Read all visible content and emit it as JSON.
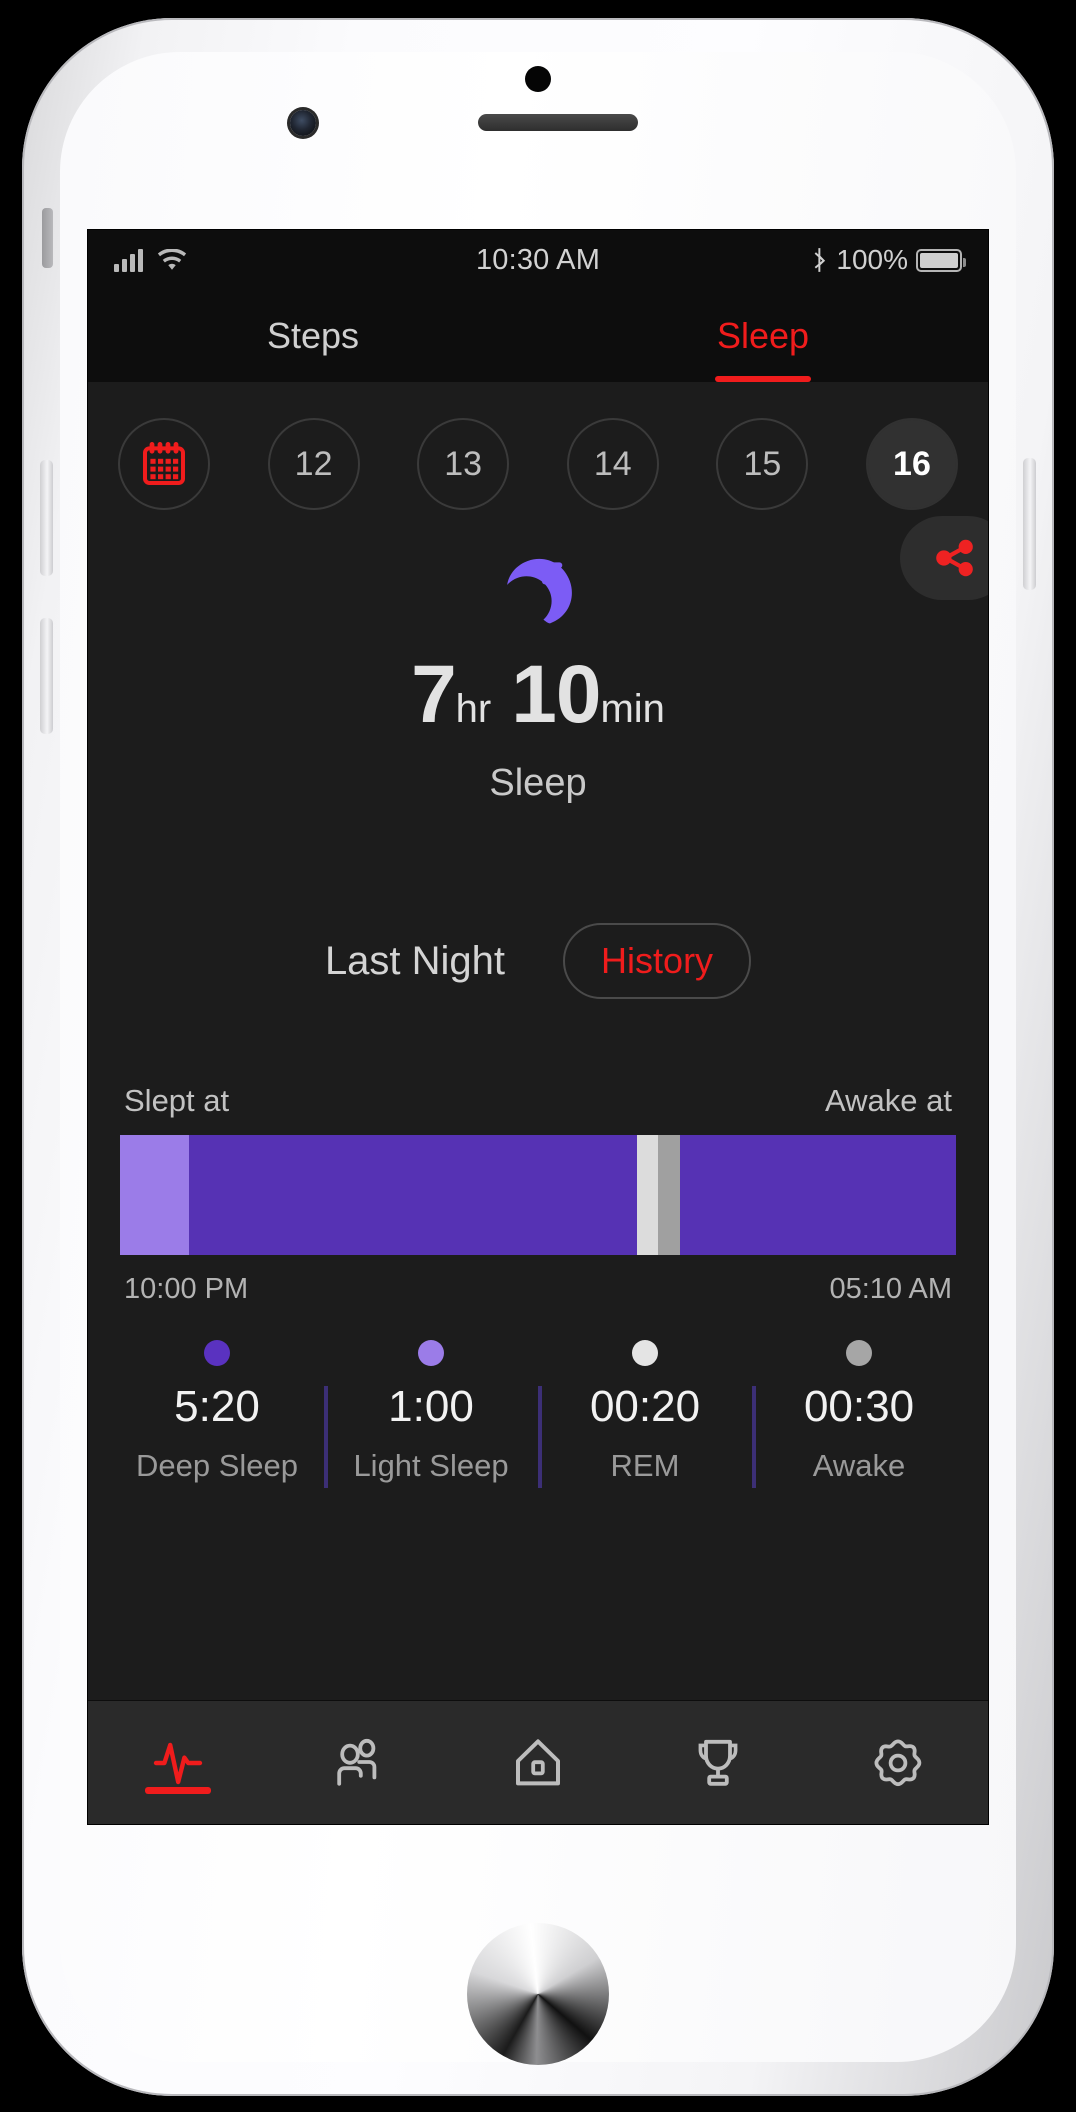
{
  "status_bar": {
    "time": "10:30 AM",
    "battery_percent": "100%",
    "signal_icon": "cellular-signal-icon",
    "wifi_icon": "wifi-icon",
    "bluetooth_icon": "bluetooth-icon",
    "battery_icon": "battery-icon"
  },
  "top_tabs": [
    {
      "label": "Steps",
      "active": false
    },
    {
      "label": "Sleep",
      "active": true
    }
  ],
  "date_strip": {
    "calendar_icon": "calendar-icon",
    "days": [
      "12",
      "13",
      "14",
      "15",
      "16"
    ],
    "selected_day": "16"
  },
  "summary": {
    "moon_icon": "moon-sleep-icon",
    "hours": "7",
    "hours_unit": "hr",
    "minutes": "10",
    "minutes_unit": "min",
    "label": "Sleep",
    "share_icon": "share-icon"
  },
  "section": {
    "title": "Last Night",
    "history_button": "History"
  },
  "chart_data": {
    "type": "bar",
    "title": "Last Night sleep stages timeline",
    "xlabel": "",
    "ylabel": "",
    "start_label": "Slept at",
    "end_label": "Awake at",
    "start_time": "10:00 PM",
    "end_time": "05:10 AM",
    "total_duration": "7hr 10min",
    "segments": [
      {
        "stage": "Light Sleep",
        "percent": 8.3,
        "color": "#9b7ce8"
      },
      {
        "stage": "Deep Sleep",
        "percent": 53.5,
        "color": "#5632b4"
      },
      {
        "stage": "REM",
        "percent": 2.6,
        "color": "#dcdcdc"
      },
      {
        "stage": "Awake",
        "percent": 2.6,
        "color": "#a0a0a0"
      },
      {
        "stage": "Deep Sleep",
        "percent": 33.0,
        "color": "#5632b4"
      }
    ],
    "legend": [
      {
        "label": "Deep Sleep",
        "value": "5:20",
        "color": "#5a32c0"
      },
      {
        "label": "Light Sleep",
        "value": "1:00",
        "color": "#9b7ce8"
      },
      {
        "label": "REM",
        "value": "00:20",
        "color": "#e4e4e4"
      },
      {
        "label": "Awake",
        "value": "00:30",
        "color": "#a6a6a6"
      }
    ]
  },
  "bottom_nav": [
    {
      "icon": "activity-pulse-icon",
      "active": true
    },
    {
      "icon": "people-icon",
      "active": false
    },
    {
      "icon": "home-icon",
      "active": false
    },
    {
      "icon": "trophy-icon",
      "active": false
    },
    {
      "icon": "settings-gear-icon",
      "active": false
    }
  ],
  "colors": {
    "accent_red": "#f01c1c",
    "deep_sleep": "#5632b4",
    "light_sleep": "#9b7ce8",
    "rem": "#dcdcdc",
    "awake": "#a0a0a0",
    "screen_bg": "#1c1c1c"
  }
}
